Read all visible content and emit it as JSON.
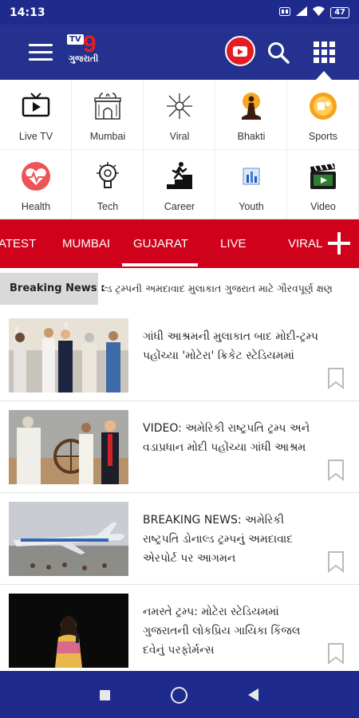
{
  "status_bar": {
    "time": "14:13",
    "network": "4G",
    "battery": "47"
  },
  "app": {
    "logo_brand": "TV9",
    "logo_sub": "ગુજરાતી",
    "brand_color": "#24318f",
    "accent_color": "#d0021b"
  },
  "categories": [
    {
      "label": "Live TV",
      "icon": "live-tv-icon"
    },
    {
      "label": "Mumbai",
      "icon": "mumbai-gateway-icon"
    },
    {
      "label": "Viral",
      "icon": "viral-icon"
    },
    {
      "label": "Bhakti",
      "icon": "bhakti-icon"
    },
    {
      "label": "Sports",
      "icon": "sports-icon"
    },
    {
      "label": "Health",
      "icon": "health-icon"
    },
    {
      "label": "Tech",
      "icon": "tech-icon"
    },
    {
      "label": "Career",
      "icon": "career-icon"
    },
    {
      "label": "Youth",
      "icon": "youth-icon"
    },
    {
      "label": "Video",
      "icon": "video-icon"
    }
  ],
  "tabs": {
    "items": [
      "ATEST",
      "MUMBAI",
      "GUJARAT",
      "LIVE",
      "VIRAL"
    ],
    "active": "GUJARAT"
  },
  "breaking": {
    "label": "Breaking News :",
    "text": "લ્ડ ટ્રમ્પની અમદાવાદ મુલાકાત ગુજરાત માટે ગૌરવપૂર્ણ ક્ષણ"
  },
  "news": [
    {
      "headline": "ગાંધી આશ્રમની મુલાકાત બાદ મોદી-ટ્રમ્પ પહોંચ્યા 'મોટેરા' ક્રિકેટ સ્ટેડિયમમાં"
    },
    {
      "headline": "VIDEO: અમેરિકી રાષ્ટ્રપતિ ટ્રમ્પ અને વડાપ્રધાન મોદી પહોંચ્યા ગાંધી આશ્રમ"
    },
    {
      "headline": "BREAKING NEWS: અમેરિકી રાષ્ટ્રપતિ ડોનાલ્ડ ટ્રમ્પનું અમદાવાદ એરપોર્ટ પર આગમન"
    },
    {
      "headline": "નમસ્તે ટ્રમ્પ: મોટેરા સ્ટેડિયમમાં ગુજરાતની લોકપ્રિય ગાયિકા કિંજલ દવેનું પરફોર્મન્સ"
    }
  ]
}
